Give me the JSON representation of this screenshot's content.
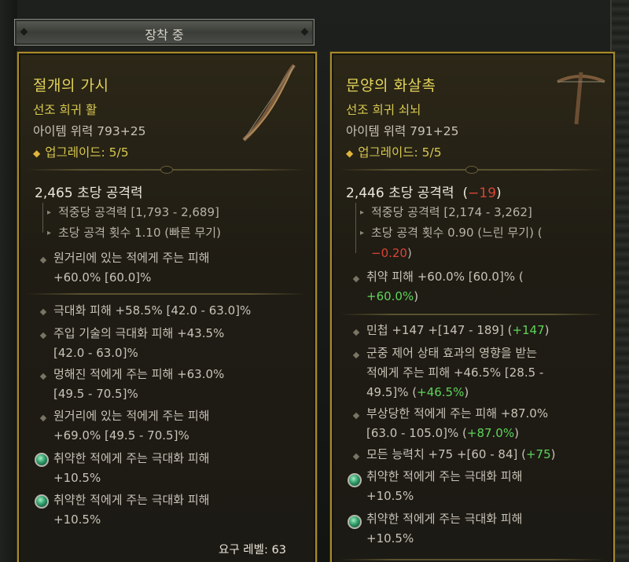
{
  "equipped": {
    "label": "장착 중"
  },
  "left_item": {
    "name": "절개의 가시",
    "rarity": "선조 희귀 활",
    "power": "아이템 위력 793+25",
    "upgrade": "업그레이드: 5/5",
    "dps": "2,465 초당 공격력",
    "sub1": "적중당 공격력 [1,793 - 2,689]",
    "sub2": "초당 공격 횟수 1.10 (빠른 무기)",
    "implicit_l1": "원거리에 있는 적에게 주는 피해",
    "implicit_l2": "+60.0% [60.0]%",
    "affixes": [
      {
        "l1": "극대화 피해 +58.5% [42.0 - 63.0]%",
        "l2": ""
      },
      {
        "l1": "주입 기술의 극대화 피해 +43.5%",
        "l2": "[42.0 - 63.0]%"
      },
      {
        "l1": "멍해진 적에게 주는 피해 +63.0%",
        "l2": "[49.5 - 70.5]%"
      },
      {
        "l1": "원거리에 있는 적에게 주는 피해",
        "l2": "+69.0% [49.5 - 70.5]%"
      }
    ],
    "gems": [
      {
        "l1": "취약한 적에게 주는 극대화 피해",
        "l2": "+10.5%"
      },
      {
        "l1": "취약한 적에게 주는 극대화 피해",
        "l2": "+10.5%"
      }
    ],
    "requirement": "요구 레벨: 63",
    "icon": "bow-icon"
  },
  "right_item": {
    "name": "문양의 화살촉",
    "rarity": "선조 희귀 쇠뇌",
    "power": "아이템 위력 791+25",
    "upgrade": "업그레이드: 5/5",
    "dps": "2,446 초당 공격력",
    "dps_delta": "−19",
    "sub1": "적중당 공격력 [2,174 - 3,262]",
    "sub2": "초당 공격 횟수 0.90 (느린 무기) (",
    "sub2_delta": "−0.20",
    "implicit_l1": "취약 피해 +60.0% [60.0]% (",
    "implicit_delta": "+60.0%",
    "affixes": [
      {
        "l1": "민첩 +147 +[147 - 189] (",
        "d1": "+147",
        "l2": "",
        "d2": ""
      },
      {
        "l1": "군중 제어 상태 효과의 영향을 받는",
        "l2": "적에게 주는 피해 +46.5% [28.5 -",
        "l3": "49.5]% (",
        "d3": "+46.5%"
      },
      {
        "l1": "부상당한 적에게 주는 피해 +87.0%",
        "l2": "[63.0 - 105.0]% (",
        "d2": "+87.0%"
      },
      {
        "l1": "모든 능력치 +75 +[60 - 84] (",
        "d1": "+75"
      }
    ],
    "gems": [
      {
        "l1": "취약한 적에게 주는 극대화 피해",
        "l2": "+10.5%"
      },
      {
        "l1": "취약한 적에게 주는 극대화 피해",
        "l2": "+10.5%"
      }
    ],
    "icon": "crossbow-icon"
  },
  "colors": {
    "title": "#e2d35a",
    "bonus": "#5fd35a",
    "penalty": "#d84437",
    "border": "#a88a2c"
  }
}
